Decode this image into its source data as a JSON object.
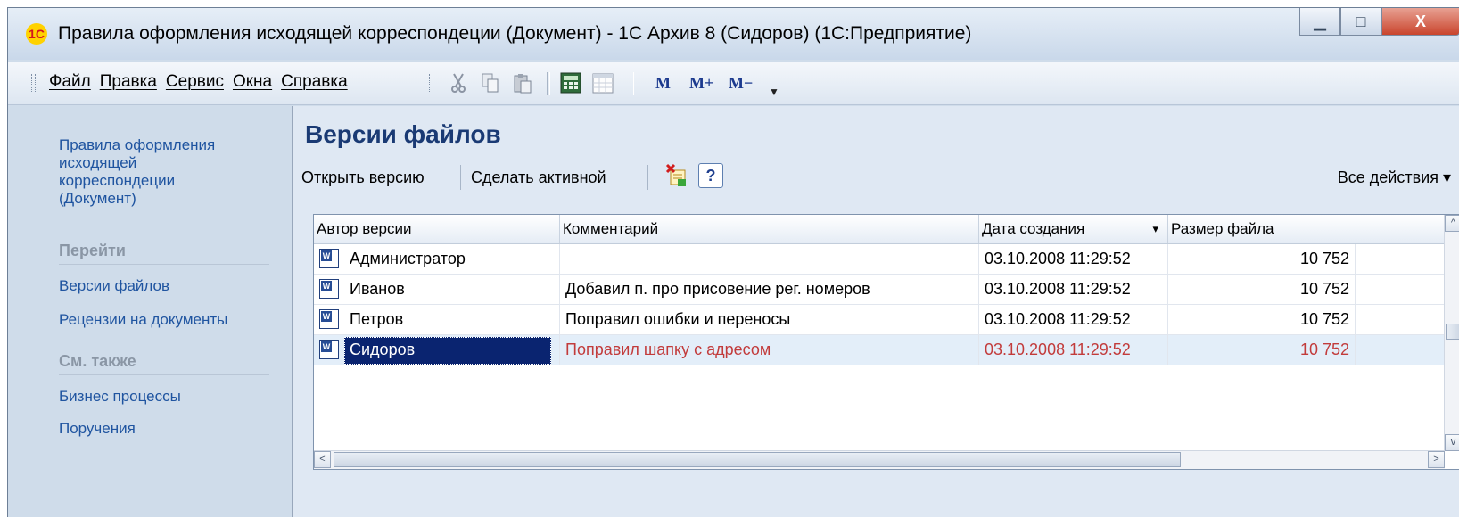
{
  "window": {
    "title": "Правила оформления исходящей корреспондеции (Документ) - 1С Архив 8 (Сидоров) (1С:Предприятие)",
    "app_icon": "1С",
    "buttons": {
      "minimize": "▁",
      "maximize": "□",
      "close": "X"
    }
  },
  "menubar": {
    "items": [
      "Файл",
      "Правка",
      "Сервис",
      "Окна",
      "Справка"
    ],
    "m_buttons": [
      "M",
      "M+",
      "M−"
    ],
    "icons": [
      "cut-icon",
      "copy-icon",
      "paste-icon",
      "calculator-icon",
      "calendar-icon",
      "dropdown-arrow-icon"
    ]
  },
  "sidebar": {
    "doc_link": [
      "Правила оформления",
      "исходящей",
      "корреспондеции",
      "(Документ)"
    ],
    "go_header": "Перейти",
    "go_items": [
      "Версии файлов",
      "Рецензии на документы"
    ],
    "see_also_header": "См. также",
    "see_also_items": [
      "Бизнес процессы",
      "Поручения"
    ]
  },
  "main": {
    "title": "Версии файлов",
    "commands": {
      "open_version": "Открыть версию",
      "make_active": "Сделать активной",
      "help": "?",
      "all_actions": "Все действия ▾"
    }
  },
  "table": {
    "columns": [
      "Автор версии",
      "Комментарий",
      "Дата создания",
      "Размер файла"
    ],
    "sort_indicator": "▾",
    "rows": [
      {
        "author": "Администратор",
        "comment": "",
        "date": "03.10.2008 11:29:52",
        "size": "10 752",
        "icon": "W"
      },
      {
        "author": "Иванов",
        "comment": "Добавил п. про присовение рег. номеров",
        "date": "03.10.2008 11:29:52",
        "size": "10 752",
        "icon": "W"
      },
      {
        "author": "Петров",
        "comment": "Поправил ошибки и переносы",
        "date": "03.10.2008 11:29:52",
        "size": "10 752",
        "icon": "W"
      },
      {
        "author": "Сидоров",
        "comment": "Поправил шапку с адресом",
        "date": "03.10.2008 11:29:52",
        "size": "10 752",
        "icon": "W"
      }
    ],
    "active_row_color": "#c23b3b",
    "selection_color": "#0a2470"
  },
  "scroll": {
    "up": "^",
    "down": "v",
    "left": "<",
    "right": ">"
  }
}
